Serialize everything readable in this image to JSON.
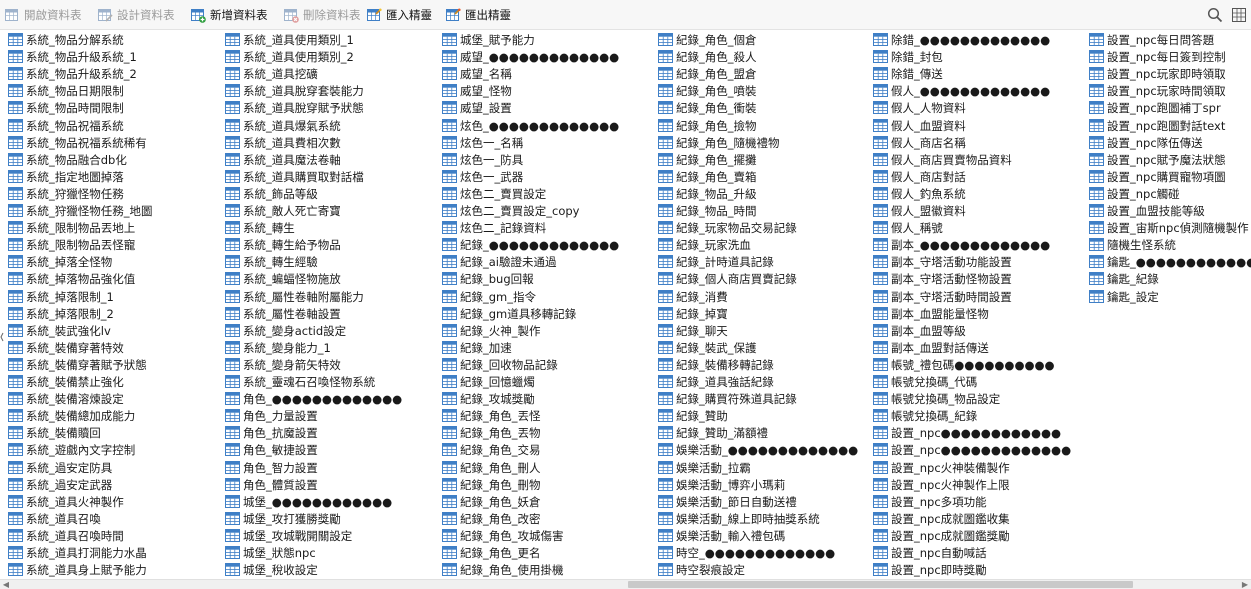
{
  "toolbar": {
    "buttons": [
      {
        "label": "開啟資料表",
        "icon": "open-table-icon",
        "enabled": false
      },
      {
        "label": "設計資料表",
        "icon": "design-table-icon",
        "enabled": false
      },
      {
        "label": "新增資料表",
        "icon": "new-table-icon",
        "enabled": true
      },
      {
        "label": "刪除資料表",
        "icon": "delete-table-icon",
        "enabled": false
      },
      {
        "label": "匯入精靈",
        "icon": "import-wizard-icon",
        "enabled": true
      },
      {
        "label": "匯出精靈",
        "icon": "export-wizard-icon",
        "enabled": true
      }
    ],
    "search_icon": "search-icon",
    "view_icon": "grid-view-icon"
  },
  "colors": {
    "table_icon_blue": "#3f7fc6",
    "header_gray": "#f7f7f7"
  },
  "columns": [
    [
      "系統_物品分解系統",
      "系統_物品升級系統_1",
      "系統_物品升級系統_2",
      "系統_物品日期限制",
      "系統_物品時間限制",
      "系統_物品祝福系統",
      "系統_物品祝福系統稀有",
      "系統_物品融合db化",
      "系統_指定地圖掉落",
      "系統_狩獵怪物任務",
      "系統_狩獵怪物任務_地圖",
      "系統_限制物品丟地上",
      "系統_限制物品丟怪寵",
      "系統_掉落全怪物",
      "系統_掉落物品強化值",
      "系統_掉落限制_1",
      "系統_掉落限制_2",
      "系統_裝武強化lv",
      "系統_裝備穿著特效",
      "系統_裝備穿著賦予狀態",
      "系統_裝備禁止強化",
      "系統_裝備溶煉設定",
      "系統_裝備總加成能力",
      "系統_裝備贖回",
      "系統_遊戲內文字控制",
      "系統_過安定防具",
      "系統_過安定武器",
      "系統_道具火神製作",
      "系統_道具召喚",
      "系統_道具召喚時間",
      "系統_道具打洞能力水晶",
      "系統_道具身上賦予能力"
    ],
    [
      "系統_道具使用類別_1",
      "系統_道具使用類別_2",
      "系統_道具挖礦",
      "系統_道具脫穿套裝能力",
      "系統_道具脫穿賦予狀態",
      "系統_道具爆氣系統",
      "系統_道具費相次數",
      "系統_道具魔法卷軸",
      "系統_道具購買取對話檔",
      "系統_飾品等級",
      "系統_敵人死亡寄寶",
      "系統_轉生",
      "系統_轉生給予物品",
      "系統_轉生經驗",
      "系統_蝙蝠怪物施放",
      "系統_屬性卷軸附屬能力",
      "系統_屬性卷軸設置",
      "系統_變身actid設定",
      "系統_變身能力_1",
      "系統_變身箭矢特效",
      "系統_靈魂石召喚怪物系統",
      "角色_●●●●●●●●●●●●●",
      "角色_力量設置",
      "角色_抗魔設置",
      "角色_敏捷設置",
      "角色_智力設置",
      "角色_體質設置",
      "城堡_●●●●●●●●●●●●",
      "城堡_攻打獲勝獎勵",
      "城堡_攻城戰開關設定",
      "城堡_狀態npc",
      "城堡_稅收設定"
    ],
    [
      "城堡_賦予能力",
      "威望_●●●●●●●●●●●●●",
      "威望_名稱",
      "威望_怪物",
      "威望_設置",
      "炫色_●●●●●●●●●●●●●",
      "炫色一_名稱",
      "炫色一_防具",
      "炫色一_武器",
      "炫色二_賣買設定",
      "炫色二_賣買設定_copy",
      "炫色二_記錄資料",
      "紀錄_●●●●●●●●●●●●●",
      "紀錄_ai驗證未通過",
      "紀錄_bug回報",
      "紀錄_gm_指令",
      "紀錄_gm道具移轉記錄",
      "紀錄_火神_製作",
      "紀錄_加速",
      "紀錄_回收物品記錄",
      "紀錄_回憶蠟燭",
      "紀錄_攻城獎勵",
      "紀錄_角色_丟怪",
      "紀錄_角色_丟物",
      "紀錄_角色_交易",
      "紀錄_角色_刪人",
      "紀錄_角色_刪物",
      "紀錄_角色_妖倉",
      "紀錄_角色_改密",
      "紀錄_角色_攻城傷害",
      "紀錄_角色_更名",
      "紀錄_角色_使用掛機"
    ],
    [
      "紀錄_角色_個倉",
      "紀錄_角色_殺人",
      "紀錄_角色_盟倉",
      "紀錄_角色_噴裝",
      "紀錄_角色_衝裝",
      "紀錄_角色_撿物",
      "紀錄_角色_隨機禮物",
      "紀錄_角色_擺攤",
      "紀錄_角色_賣箱",
      "紀錄_物品_升級",
      "紀錄_物品_時間",
      "紀錄_玩家物品交易記錄",
      "紀錄_玩家洗血",
      "紀錄_計時道具記錄",
      "紀錄_個人商店買賣記錄",
      "紀錄_消費",
      "紀錄_掉寶",
      "紀錄_聊天",
      "紀錄_裝武_保護",
      "紀錄_裝備移轉記錄",
      "紀錄_道具強話紀錄",
      "紀錄_購買符殊道具記錄",
      "紀錄_贊助",
      "紀錄_贊助_滿額禮",
      "娛樂活動_●●●●●●●●●●●●●",
      "娛樂活動_拉霸",
      "娛樂活動_博弈小瑪莉",
      "娛樂活動_節日自動送禮",
      "娛樂活動_線上即時抽獎系統",
      "娛樂活動_輸入禮包碼",
      "時空_●●●●●●●●●●●●●",
      "時空裂痕設定"
    ],
    [
      "除錯_●●●●●●●●●●●●●",
      "除錯_封包",
      "除錯_傳送",
      "假人_●●●●●●●●●●●●●",
      "假人_人物資料",
      "假人_血盟資料",
      "假人_商店名稱",
      "假人_商店買賣物品資料",
      "假人_商店對話",
      "假人_釣魚系統",
      "假人_盟徽資料",
      "假人_稱號",
      "副本_●●●●●●●●●●●●●",
      "副本_守塔活動功能設置",
      "副本_守塔活動怪物設置",
      "副本_守塔活動時間設置",
      "副本_血盟能量怪物",
      "副本_血盟等級",
      "副本_血盟對話傳送",
      "帳號_禮包碼●●●●●●●●●●",
      "帳號兌換碼_代碼",
      "帳號兌換碼_物品設定",
      "帳號兌換碼_紀錄",
      "設置_npc●●●●●●●●●●●●",
      "設置_npc●●●●●●●●●●●●●",
      "設置_npc火神裝備製作",
      "設置_npc火神製作上限",
      "設置_npc多項功能",
      "設置_npc成就圖鑑收集",
      "設置_npc成就圖鑑獎勵",
      "設置_npc自動喊話",
      "設置_npc即時獎勵"
    ],
    [
      "設置_npc每日問答題",
      "設置_npc每日簽到控制",
      "設置_npc玩家即時領取",
      "設置_npc玩家時間領取",
      "設置_npc跑圖補丁spr",
      "設置_npc跑圖對話text",
      "設置_npc隊伍傳送",
      "設置_npc賦予魔法狀態",
      "設置_npc購買寵物項圖",
      "設置_npc觸碰",
      "設置_血盟技能等級",
      "設置_宙斯npc偵測隨機製作",
      "隨機生怪系統",
      "鑰匙_●●●●●●●●●●●●●",
      "鑰匙_紀錄",
      "鑰匙_設定"
    ]
  ]
}
